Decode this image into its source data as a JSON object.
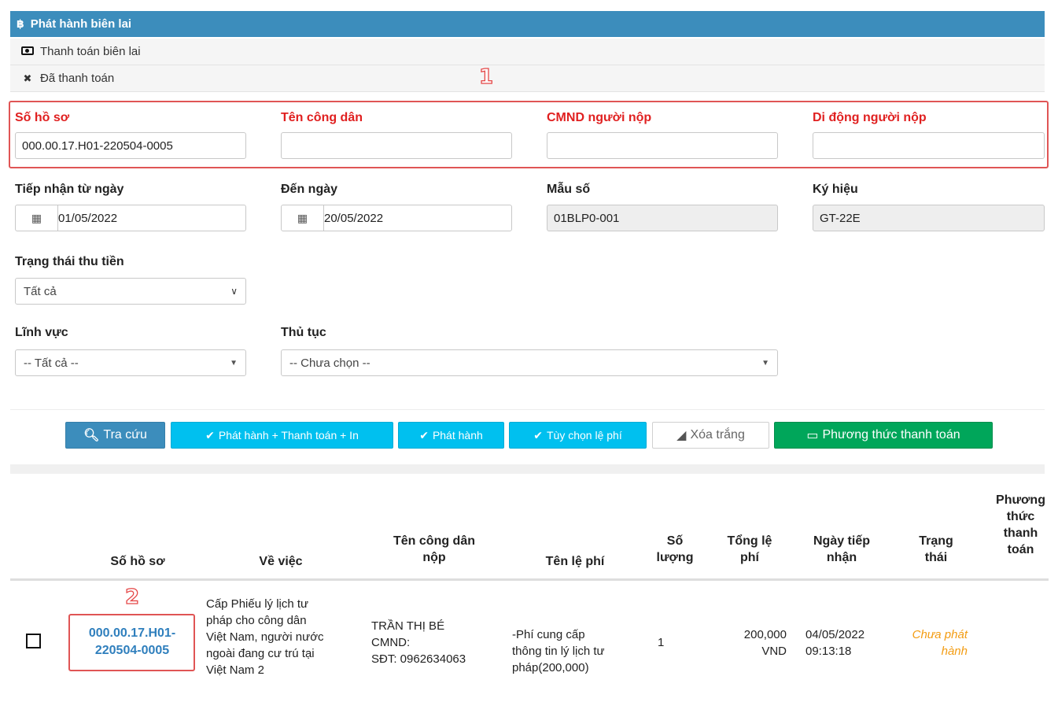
{
  "header": {
    "title": "Phát hành biên lai",
    "menu": [
      {
        "label": "Thanh toán biên lai",
        "icon": "money-icon"
      },
      {
        "label": "Đã thanh toán",
        "icon": "close-icon"
      }
    ]
  },
  "annotations": {
    "one": "1",
    "two": "2"
  },
  "filters": {
    "so_ho_so": {
      "label": "Số hồ sơ",
      "value": "000.00.17.H01-220504-0005"
    },
    "ten_cong_dan": {
      "label": "Tên công dân",
      "value": ""
    },
    "cmnd": {
      "label": "CMND người nộp",
      "value": ""
    },
    "di_dong": {
      "label": "Di động người nộp",
      "value": ""
    },
    "tu_ngay": {
      "label": "Tiếp nhận từ ngày",
      "value": "01/05/2022"
    },
    "den_ngay": {
      "label": "Đến ngày",
      "value": "20/05/2022"
    },
    "mau_so": {
      "label": "Mẫu số",
      "value": "01BLP0-001"
    },
    "ky_hieu": {
      "label": "Ký hiệu",
      "value": "GT-22E"
    },
    "trang_thai": {
      "label": "Trạng thái thu tiền",
      "value": "Tất cả"
    },
    "linh_vuc": {
      "label": "Lĩnh vực",
      "value": "-- Tất cả --"
    },
    "thu_tuc": {
      "label": "Thủ tục",
      "value": "-- Chưa chọn --"
    }
  },
  "buttons": {
    "tra_cuu": "Tra cứu",
    "phat_hanh_tt_in": "Phát hành + Thanh toán + In",
    "phat_hanh": "Phát hành",
    "tuy_chon": "Tùy chọn lệ phí",
    "xoa_trang": "Xóa trắng",
    "phuong_thuc": "Phương thức thanh toán"
  },
  "table": {
    "headers": {
      "so_ho_so": "Số hồ sơ",
      "ve_viec": "Về việc",
      "ten_cong_dan": [
        "Tên công dân",
        "nộp"
      ],
      "ten_le_phi": "Tên lệ phí",
      "so_luong": [
        "Số",
        "lượng"
      ],
      "tong_le_phi": [
        "Tổng lệ",
        "phí"
      ],
      "ngay_tiep_nhan": [
        "Ngày tiếp",
        "nhận"
      ],
      "trang_thai": [
        "Trạng",
        "thái"
      ],
      "phuong_thuc": [
        "Phương",
        "thức",
        "thanh",
        "toán"
      ]
    },
    "rows": [
      {
        "so_ho_so": [
          "000.00.17.H01-",
          "220504-0005"
        ],
        "ve_viec": [
          "Cấp Phiếu lý lịch tư",
          "pháp cho công dân",
          "Việt Nam, người nước",
          "ngoài đang cư trú tại",
          "Việt Nam 2"
        ],
        "ten_cong_dan": [
          "TRẦN THỊ BÉ",
          "CMND:",
          "SĐT: 0962634063"
        ],
        "ten_le_phi": [
          "-Phí cung cấp",
          "thông tin lý lịch tư",
          "pháp(200,000)"
        ],
        "so_luong": "1",
        "tong_le_phi": [
          "200,000",
          "VND"
        ],
        "ngay_tiep_nhan": [
          "04/05/2022",
          "09:13:18"
        ],
        "trang_thai": [
          "Chưa phát",
          "hành"
        ],
        "phuong_thuc": ""
      }
    ]
  },
  "colors": {
    "header_bg": "#3c8dbc",
    "highlight_red": "#e05555",
    "label_red": "#e02020",
    "button_cyan": "#00c0ef",
    "button_green": "#00a65a",
    "status_orange": "#f39c12",
    "link_blue": "#2f7fbd"
  }
}
